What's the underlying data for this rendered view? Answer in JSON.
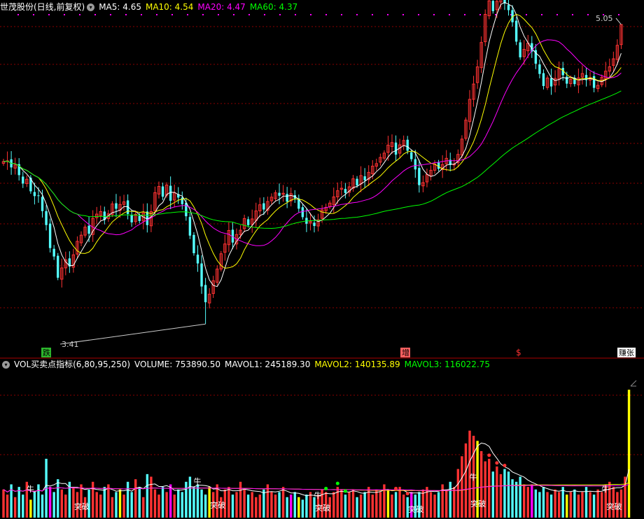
{
  "header": {
    "title": "世茂股份(日线,前复权)",
    "ma5": "MA5: 4.65",
    "ma10": "MA10: 4.54",
    "ma20": "MA20: 4.47",
    "ma60": "MA60: 4.37"
  },
  "vol_header": {
    "title": "VOL买卖点指标(6,80,95,250)",
    "volume": "VOLUME: 753890.50",
    "mavol1": "MAVOL1: 245189.30",
    "mavol2": "MAVOL2: 140135.89",
    "mavol3": "MAVOL3: 116022.75"
  },
  "colors": {
    "up": "#ff3232",
    "down": "#54ffff",
    "ma5": "#ffffff",
    "ma10": "#ffff00",
    "ma20": "#ff00ff",
    "ma60": "#00ff00",
    "grid": "#8b0000",
    "bg": "#000000"
  },
  "markers": {
    "low": "3.41",
    "high": "5.05",
    "sig1": "跌",
    "sig2": "增",
    "sig3": "$",
    "sig4": "赚张",
    "niu": "牛",
    "tupo": "突破"
  },
  "chart_data": [
    {
      "type": "candlestick",
      "title": "世茂股份(日线,前复权)",
      "ylim": [
        3.3,
        5.1
      ],
      "close_start": 4.3,
      "close_target": 5.05,
      "lowest_low": 3.41,
      "highest_high": 5.05,
      "ma_periods": [
        5,
        10,
        20,
        60
      ],
      "last_ma_values": {
        "MA5": 4.65,
        "MA10": 4.54,
        "MA20": 4.47,
        "MA60": 4.37
      },
      "steps": [
        0.01,
        -0.03,
        0.02,
        -0.05,
        -0.04,
        0.03,
        -0.06,
        -0.02,
        0.01,
        -0.08,
        -0.07,
        -0.12,
        -0.04,
        -0.11,
        0.06,
        0.05,
        -0.03,
        0.07,
        0.08,
        0.04,
        0.05,
        -0.03,
        0.09,
        0.03,
        0.02,
        -0.04,
        0.04,
        0.06,
        -0.02,
        0.03,
        0.02,
        -0.06,
        -0.04,
        0.05,
        -0.03,
        0.05,
        -0.06,
        0.08,
        0.11,
        0.04,
        -0.05,
        0.07,
        -0.08,
        0.05,
        -0.02,
        -0.03,
        -0.06,
        -0.1,
        -0.09,
        -0.05,
        -0.12,
        -0.08,
        0.05,
        0.08,
        0.07,
        0.09,
        0.06,
        0.08,
        -0.06,
        0.05,
        0.03,
        0.07,
        -0.03,
        0.04,
        0.05,
        0.04,
        -0.02,
        0.05,
        0.03,
        0.03,
        -0.01,
        0.02,
        -0.04,
        0.05,
        -0.02,
        -0.05,
        -0.04,
        -0.03,
        0.02,
        -0.02,
        0.04,
        0.06,
        0.02,
        0.03,
        0.04,
        0.04,
        0.02,
        -0.02,
        0.04,
        0.05,
        -0.03,
        0.06,
        -0.02,
        0.05,
        0.04,
        0.02,
        0.04,
        0.03,
        0.05,
        0.02,
        -0.06,
        0.06,
        0.03,
        -0.05,
        -0.04,
        -0.05,
        -0.08,
        0.02,
        0.05,
        0.03,
        0.04,
        -0.02,
        0.03,
        0.04,
        -0.03,
        0.01,
        0.06,
        0.09,
        0.11,
        0.12,
        0.09,
        0.1,
        0.14,
        0.16,
        0.08,
        -0.05,
        0.06,
        0.04,
        -0.04,
        -0.03,
        -0.06,
        -0.1,
        -0.08,
        0.05,
        0.04,
        -0.04,
        -0.06,
        -0.05,
        -0.06,
        0.05,
        -0.04,
        0.05,
        0.06,
        -0.03,
        -0.04,
        0.03,
        -0.02,
        0.04,
        0.03,
        -0.03,
        0.02,
        -0.05,
        0.02,
        0.05,
        0.04,
        0.03,
        0.05,
        0.08,
        0.12
      ]
    },
    {
      "type": "bar",
      "title": "VOL买卖点指标(6,80,95,250)",
      "series": [
        {
          "name": "VOLUME",
          "last": 753890.5
        },
        {
          "name": "MAVOL1",
          "last": 245189.3
        },
        {
          "name": "MAVOL2",
          "last": 140135.89
        },
        {
          "name": "MAVOL3",
          "last": 116022.75
        }
      ],
      "ylim": [
        0,
        800000
      ],
      "base_volume": 150000,
      "volume_factors": [
        1.1,
        0.9,
        1.3,
        0.8,
        1.2,
        0.9,
        1.4,
        0.7,
        1.0,
        1.3,
        0.9,
        2.3,
        1.2,
        1.0,
        1.5,
        1.1,
        0.9,
        1.4,
        1.2,
        1.0,
        1.3,
        0.8,
        1.1,
        1.4,
        1.0,
        0.9,
        1.2,
        1.3,
        0.8,
        1.0,
        1.1,
        0.9,
        1.4,
        1.0,
        1.5,
        1.2,
        0.8,
        1.7,
        1.6,
        1.1,
        0.9,
        1.2,
        1.0,
        1.3,
        0.9,
        1.1,
        1.0,
        1.4,
        1.6,
        1.2,
        1.3,
        1.1,
        0.9,
        1.2,
        1.0,
        1.3,
        0.8,
        1.1,
        1.2,
        0.9,
        1.0,
        1.4,
        1.1,
        0.9,
        1.0,
        0.8,
        0.9,
        1.1,
        1.3,
        1.0,
        0.9,
        1.0,
        1.2,
        0.8,
        0.9,
        1.0,
        0.8,
        0.7,
        0.9,
        1.0,
        0.8,
        0.9,
        1.1,
        1.0,
        0.8,
        1.0,
        1.2,
        1.1,
        0.9,
        1.0,
        1.1,
        0.8,
        0.9,
        1.0,
        1.2,
        0.9,
        1.1,
        1.0,
        1.3,
        1.1,
        0.9,
        1.0,
        1.2,
        0.9,
        0.8,
        1.0,
        0.9,
        1.0,
        1.1,
        1.2,
        1.0,
        0.9,
        1.0,
        1.3,
        1.1,
        1.4,
        1.2,
        1.9,
        2.4,
        2.9,
        3.4,
        3.2,
        3.0,
        2.6,
        2.2,
        2.3,
        1.8,
        2.0,
        1.7,
        1.9,
        1.8,
        1.5,
        1.4,
        1.6,
        1.3,
        1.2,
        1.3,
        1.1,
        1.0,
        1.2,
        1.0,
        0.9,
        1.1,
        1.0,
        1.2,
        0.9,
        1.0,
        1.1,
        0.9,
        1.0,
        1.2,
        1.0,
        0.9,
        1.1,
        1.0,
        1.3,
        1.4,
        1.2,
        1.0,
        1.1,
        1.6,
        5.0
      ]
    }
  ]
}
